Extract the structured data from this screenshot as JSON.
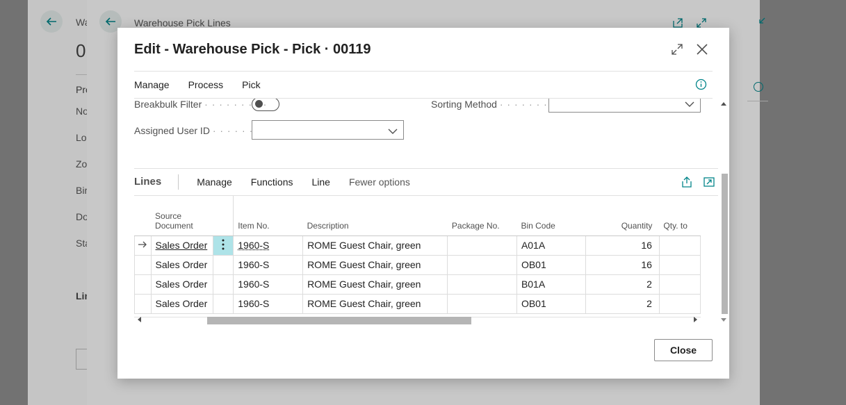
{
  "background": {
    "page1_title_partial": "Wa",
    "page1_number_partial": "0",
    "page1_section_partial": "Pro",
    "page1_fields_partial": [
      "No",
      "Lo",
      "Zo",
      "Bir",
      "Do",
      "Sta"
    ],
    "page1_lines_partial": "Lin",
    "page2_title": "Warehouse Pick Lines"
  },
  "dialog": {
    "title": "Edit - Warehouse Pick - Pick · 00119",
    "actions": [
      "Manage",
      "Process",
      "Pick"
    ],
    "fields": {
      "breakbulk_filter_label": "Breakbulk Filter",
      "breakbulk_filter_value": false,
      "sorting_method_label": "Sorting Method",
      "sorting_method_value": "",
      "assigned_user_id_label": "Assigned User ID",
      "assigned_user_id_value": ""
    },
    "lines": {
      "title": "Lines",
      "actions": [
        "Manage",
        "Functions",
        "Line"
      ],
      "fewer_options": "Fewer options",
      "columns": {
        "source_document_1": "Source",
        "source_document_2": "Document",
        "item_no": "Item No.",
        "description": "Description",
        "package_no": "Package No.",
        "bin_code": "Bin Code",
        "quantity": "Quantity",
        "qty_to": "Qty. to"
      },
      "rows": [
        {
          "source_document": "Sales Order",
          "item_no": "1960-S",
          "description": "ROME Guest Chair, green",
          "package_no": "",
          "bin_code": "A01A",
          "quantity": "16"
        },
        {
          "source_document": "Sales Order",
          "item_no": "1960-S",
          "description": "ROME Guest Chair, green",
          "package_no": "",
          "bin_code": "OB01",
          "quantity": "16"
        },
        {
          "source_document": "Sales Order",
          "item_no": "1960-S",
          "description": "ROME Guest Chair, green",
          "package_no": "",
          "bin_code": "B01A",
          "quantity": "2"
        },
        {
          "source_document": "Sales Order",
          "item_no": "1960-S",
          "description": "ROME Guest Chair, green",
          "package_no": "",
          "bin_code": "OB01",
          "quantity": "2"
        }
      ]
    },
    "close_label": "Close"
  },
  "colors": {
    "accent": "#008489",
    "selected_cell": "#aee3e8"
  }
}
